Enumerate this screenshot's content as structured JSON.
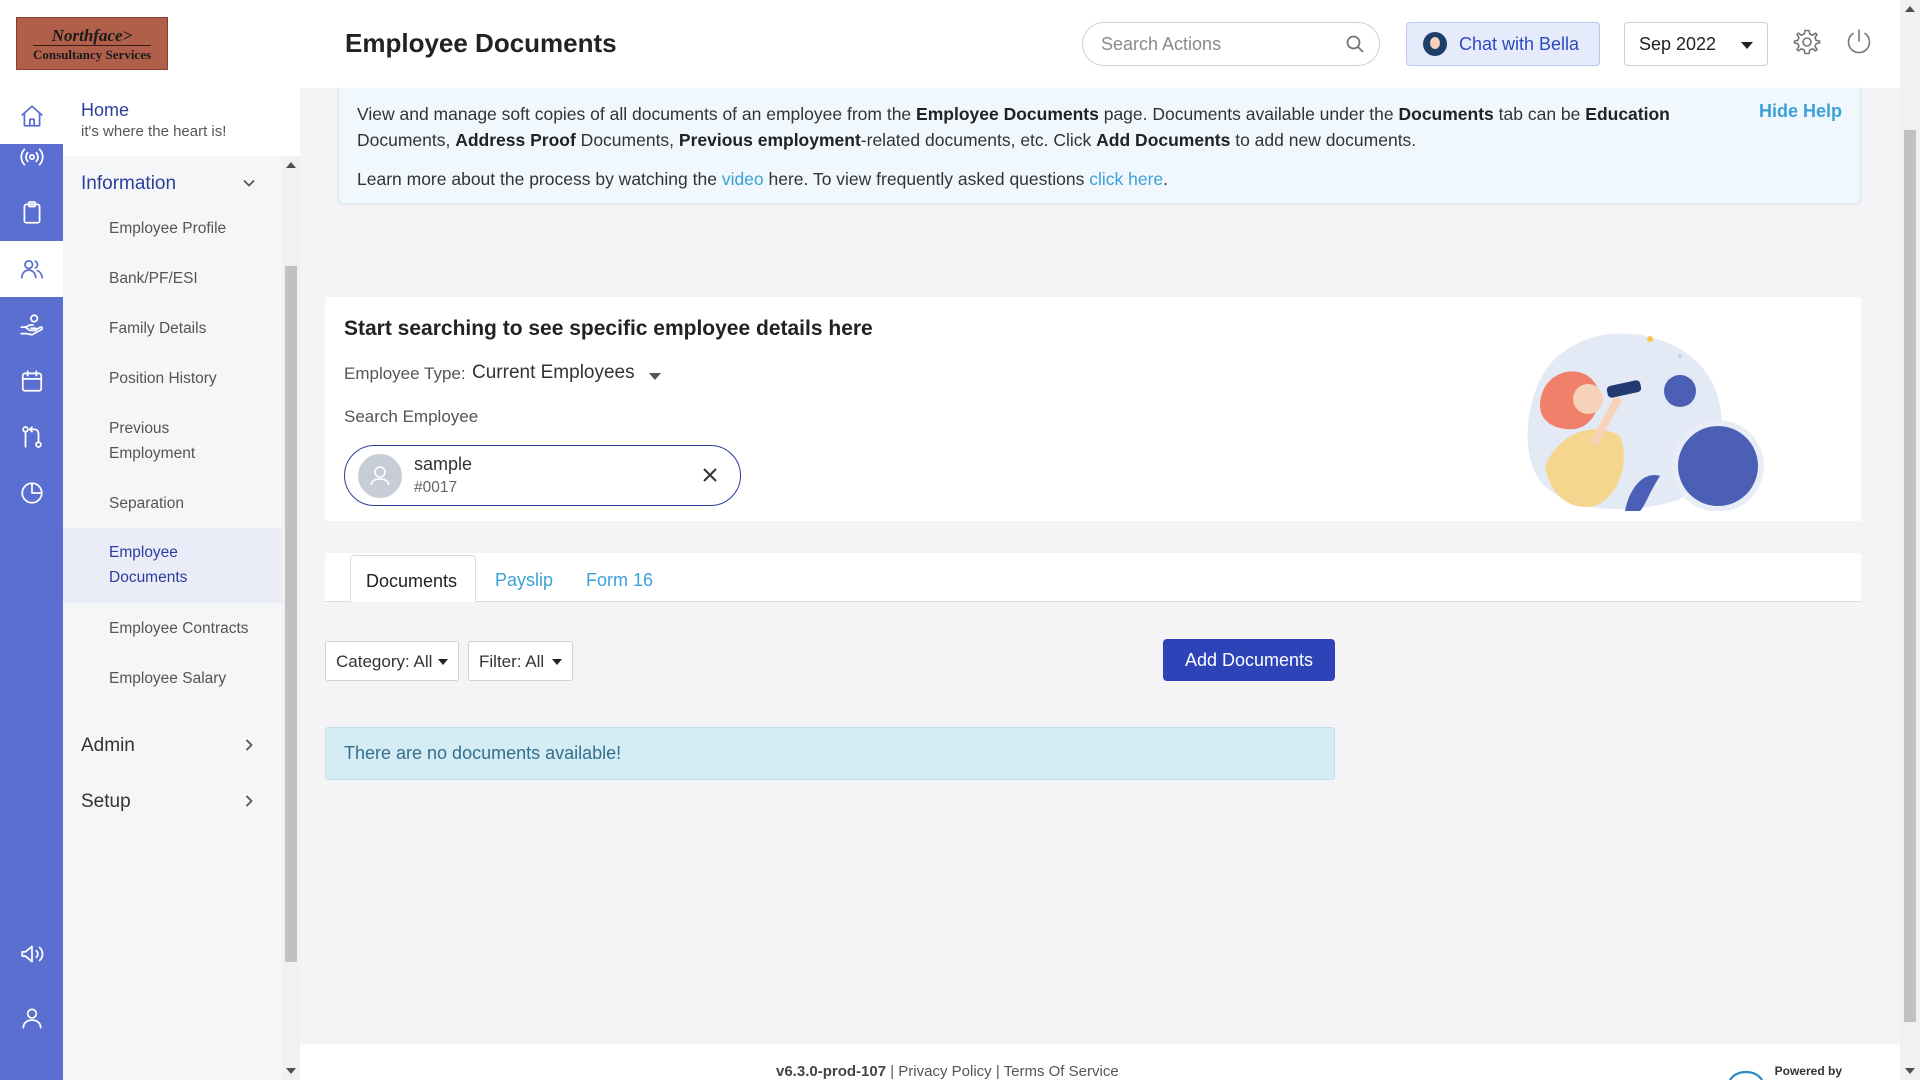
{
  "brand": {
    "logo_line1": "Northface>",
    "logo_line2": "Consultancy Services"
  },
  "header": {
    "title": "Employee Documents",
    "search_placeholder": "Search Actions",
    "chat_label": "Chat with Bella",
    "month": "Sep 2022"
  },
  "rail": {
    "icons": [
      "home-icon",
      "broadcast-icon",
      "clipboard-icon",
      "people-icon",
      "hand-coin-icon",
      "calendar-icon",
      "workflow-icon",
      "pie-chart-icon",
      "megaphone-icon",
      "user-icon"
    ],
    "active": "people-icon"
  },
  "sidebar": {
    "home_title": "Home",
    "home_subtitle": "it's where the heart is!",
    "section_information": "Information",
    "items": [
      {
        "label": "Employee Profile"
      },
      {
        "label": "Bank/PF/ESI"
      },
      {
        "label": "Family Details"
      },
      {
        "label": "Position History"
      },
      {
        "label": "Previous Employment"
      },
      {
        "label": "Separation"
      },
      {
        "label": "Employee Documents",
        "active": true
      },
      {
        "label": "Employee Contracts"
      },
      {
        "label": "Employee Salary"
      }
    ],
    "section_admin": "Admin",
    "section_setup": "Setup"
  },
  "help": {
    "hide_label": "Hide Help",
    "l1_a": "View and manage soft copies of all documents of an employee from the ",
    "l1_b": "Employee Documents",
    "l1_c": " page. Documents available under the ",
    "l1_d": "Documents",
    "l1_e": " tab can be ",
    "l1_f": "Education",
    "l2_a": "Documents, ",
    "l2_b": "Address Proof",
    "l2_c": " Documents, ",
    "l2_d": "Previous employment",
    "l2_e": "-related documents, etc. Click ",
    "l2_f": "Add Documents",
    "l2_g": " to add new documents.",
    "l3_a": "Learn more about the process by watching the ",
    "l3_link1": "video",
    "l3_b": " here. To view frequently asked questions ",
    "l3_link2": "click here",
    "l3_c": "."
  },
  "search_card": {
    "title": "Start searching to see specific employee details here",
    "type_label": "Employee Type:",
    "type_value": "Current Employees",
    "search_label": "Search Employee",
    "employee_name": "sample",
    "employee_id": "#0017"
  },
  "tabs": [
    {
      "label": "Documents",
      "active": true
    },
    {
      "label": "Payslip"
    },
    {
      "label": "Form 16"
    }
  ],
  "filters": {
    "category": "Category: All",
    "filter": "Filter: All"
  },
  "add_documents_label": "Add Documents",
  "empty_message": "There are no documents available!",
  "footer": {
    "version": "v6.3.0-prod-107",
    "sep": "|",
    "privacy": "Privacy Policy",
    "terms": "Terms Of Service",
    "powered_by": "Powered by"
  },
  "colors": {
    "primary": "#2c44b8",
    "rail": "#5b6fd0",
    "link": "#3ba1d8",
    "info_bg": "#d6ecf4"
  }
}
